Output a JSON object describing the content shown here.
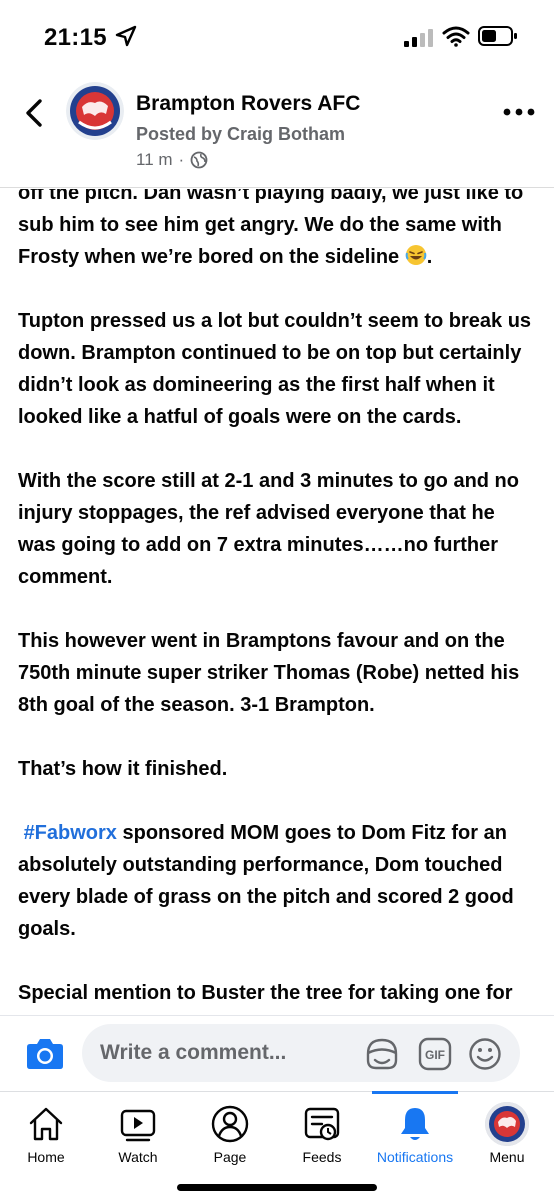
{
  "status_bar": {
    "time": "21:15"
  },
  "header": {
    "page_name": "Brampton Rovers AFC",
    "posted_by": "Posted by Craig Botham",
    "time_ago": "11 m",
    "dot": "·"
  },
  "post": {
    "p1": "off the pitch.  Dan wasn’t playing badly, we just like to sub him to see him get angry.   We do the same with Frosty when we’re bored on the sideline",
    "p2": "Tupton pressed us a lot but couldn’t seem to break us down.  Brampton continued to be on top but certainly didn’t look as domineering as the first half when it looked like a hatful of goals were on the cards.",
    "p3": "With the score still at 2-1 and 3 minutes to go and no injury stoppages, the ref advised everyone that he was going to add on 7 extra minutes……no further comment.",
    "p4": "This however went in Bramptons favour and on the 750th minute super striker Thomas (Robe) netted his 8th goal of the season.  3-1 Brampton.",
    "p5": "That’s how it finished.",
    "p6_hashtag": "#Fabworx",
    "p6_text": " sponsored MOM goes to Dom Fitz  for an absolutely outstanding performance, Dom touched every blade of grass on the pitch and scored 2 good goals.",
    "p7": "Special mention to Buster the tree for taking one for the team and going in goal."
  },
  "comment_bar": {
    "placeholder": "Write a comment..."
  },
  "tabs": [
    {
      "label": "Home",
      "icon": "home-icon"
    },
    {
      "label": "Watch",
      "icon": "watch-icon"
    },
    {
      "label": "Page",
      "icon": "page-icon"
    },
    {
      "label": "Feeds",
      "icon": "feeds-icon"
    },
    {
      "label": "Notifications",
      "icon": "bell-icon",
      "active": true
    },
    {
      "label": "Menu",
      "icon": "menu-avatar"
    }
  ],
  "colors": {
    "accent": "#1877f2",
    "hashtag": "#216fdb",
    "secondary_text": "#65676b"
  }
}
